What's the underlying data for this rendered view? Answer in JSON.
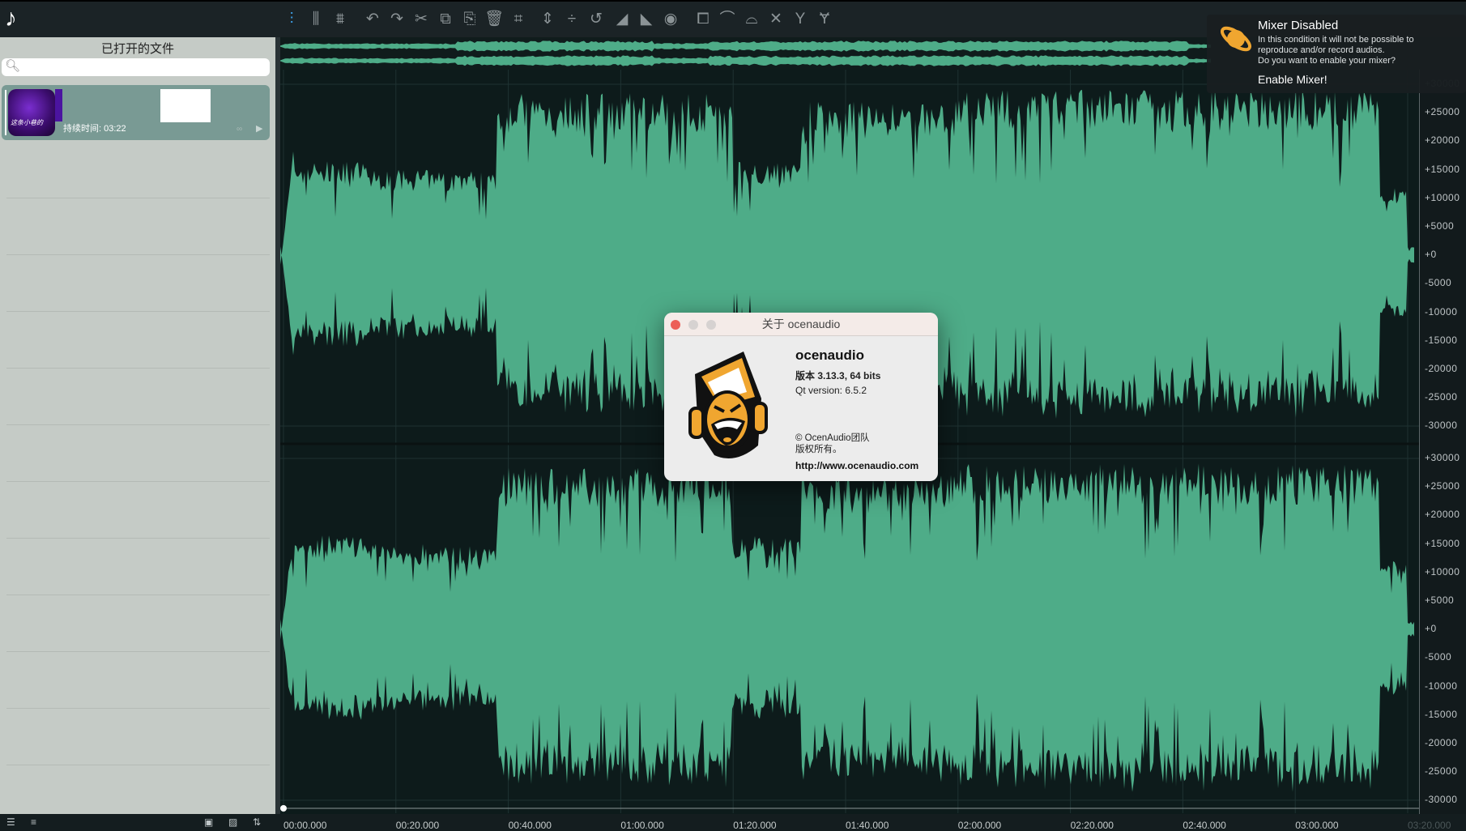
{
  "toolbar": {
    "icons": [
      "waveform-view-icon",
      "spectrum-view-icon",
      "spectrogram-view-icon",
      "undo-icon",
      "redo-icon",
      "cut-icon",
      "copy-icon",
      "paste-icon",
      "delete-icon",
      "crop-icon",
      "normalize-icon",
      "silence-icon",
      "reverse-icon",
      "fade-in-icon",
      "fade-out-icon",
      "effects-icon",
      "duplicate-icon",
      "curve-in-icon",
      "curve-out-icon",
      "crossfade-icon",
      "merge-icon",
      "split-icon"
    ]
  },
  "sidebar": {
    "title": "已打开的文件",
    "search_placeholder": "",
    "file": {
      "duration": "持续时间: 03:22",
      "cover_text": "这条小巷的"
    }
  },
  "mixer": {
    "title": "Mixer Disabled",
    "lines": [
      "In this condition it will not be possible to",
      "reproduce and/or record audios.",
      "Do you want to enable your mixer?"
    ],
    "button": "Enable Mixer!",
    "accent": "#f0a630"
  },
  "dialog": {
    "title": "关于 ocenaudio",
    "app_name": "ocenaudio",
    "version": "版本 3.13.3, 64 bits",
    "qt": "Qt version: 6.5.2",
    "copyright": "© OcenAudio团队",
    "rights": "版权所有。",
    "url": "http://www.ocenaudio.com"
  },
  "waveform": {
    "color": "#4eac88",
    "background": "#0d1b1b",
    "duration_label": "03:22",
    "y_ticks": [
      "+30000",
      "+25000",
      "+20000",
      "+15000",
      "+10000",
      "+5000",
      "+0",
      "-5000",
      "-10000",
      "-15000",
      "-20000",
      "-25000",
      "-30000"
    ],
    "time_ticks": [
      "00:00.000",
      "00:20.000",
      "00:40.000",
      "01:00.000",
      "01:20.000",
      "01:40.000",
      "02:00.000",
      "02:20.000",
      "02:40.000",
      "03:00.000",
      "03:20.000"
    ]
  }
}
